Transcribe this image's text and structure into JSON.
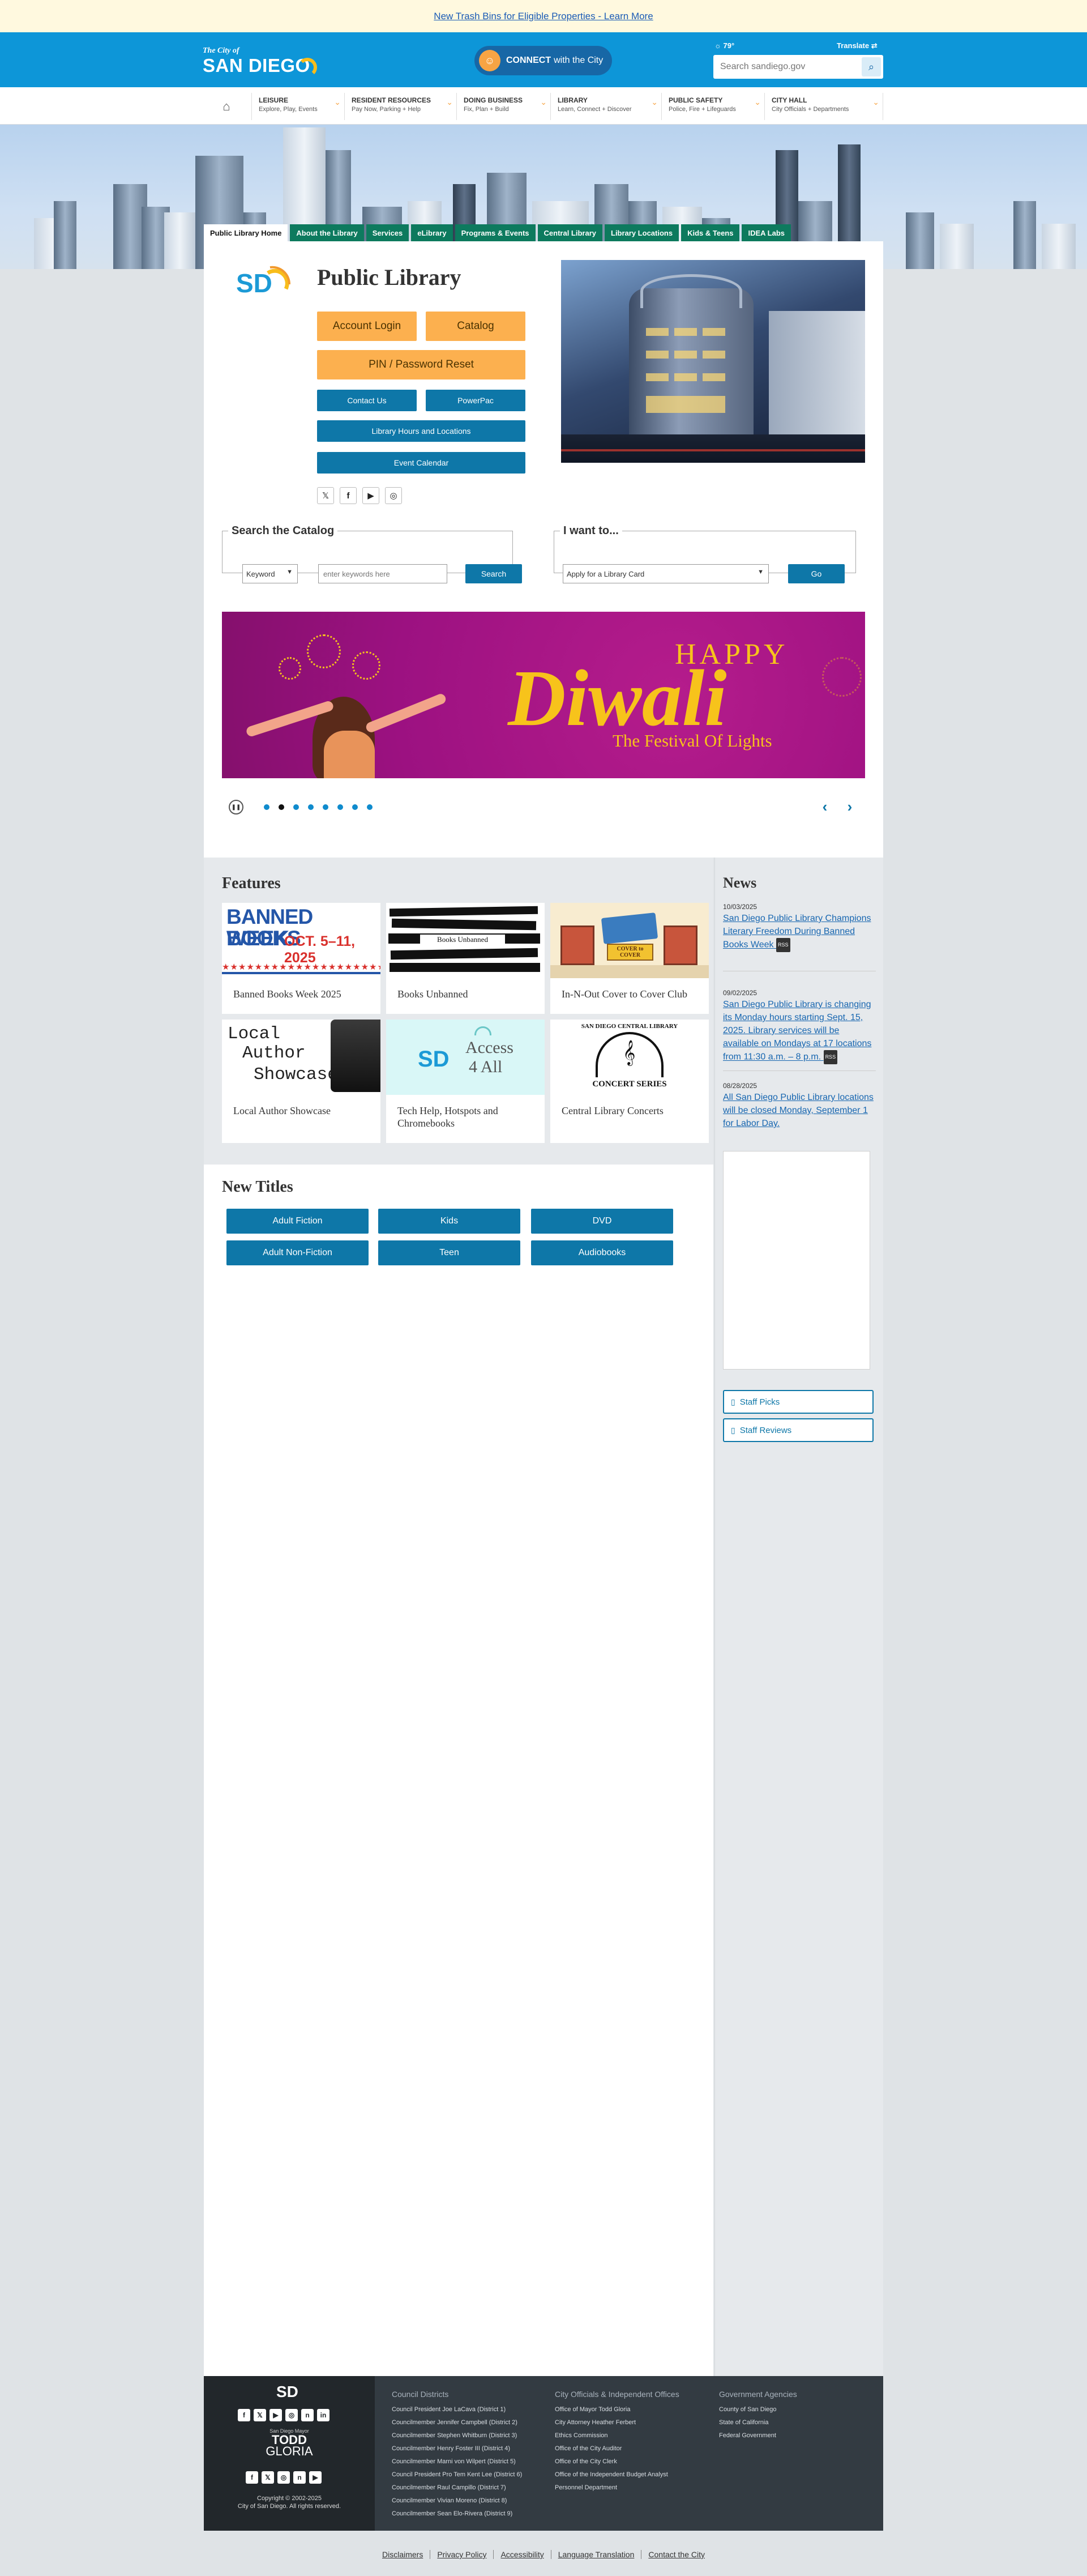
{
  "announcement": "New Trash Bins for Eligible Properties - Learn More",
  "header": {
    "logo_small": "The City of",
    "logo_big": "SAN DIEGO",
    "connect_bold": "CONNECT",
    "connect_rest": "with the City",
    "weather": "79°",
    "translate": "Translate",
    "search_placeholder": "Search sandiego.gov"
  },
  "nav": [
    {
      "title": "LEISURE",
      "sub": "Explore, Play, Events"
    },
    {
      "title": "RESIDENT RESOURCES",
      "sub": "Pay Now, Parking + Help"
    },
    {
      "title": "DOING BUSINESS",
      "sub": "Fix, Plan + Build"
    },
    {
      "title": "LIBRARY",
      "sub": "Learn, Connect + Discover"
    },
    {
      "title": "PUBLIC SAFETY",
      "sub": "Police, Fire + Lifeguards"
    },
    {
      "title": "CITY HALL",
      "sub": "City Officials + Departments"
    }
  ],
  "lib_tabs": [
    "Public Library Home",
    "About the Library",
    "Services",
    "eLibrary",
    "Programs & Events",
    "Central Library",
    "Library Locations",
    "Kids & Teens",
    "IDEA Labs"
  ],
  "library": {
    "logo_text": "SD",
    "title": "Public Library",
    "account_login": "Account Login",
    "catalog": "Catalog",
    "pin_reset": "PIN / Password Reset",
    "contact_us": "Contact Us",
    "powerpac": "PowerPac",
    "hours": "Library Hours and Locations",
    "event_calendar": "Event Calendar"
  },
  "catalog_search": {
    "legend": "Search the Catalog",
    "type_selected": "Keyword",
    "placeholder": "enter keywords here",
    "button": "Search"
  },
  "i_want": {
    "legend": "I want to...",
    "selected": "Apply for a Library Card",
    "button": "Go"
  },
  "banner": {
    "happy": "HAPPY",
    "diwali": "Diwali",
    "subtitle": "The Festival Of Lights"
  },
  "carousel": {
    "slides": 8,
    "active": 1
  },
  "features": {
    "title": "Features",
    "cards": [
      {
        "caption": "Banned Books Week 2025",
        "img_line1": "BANNED BOOKS",
        "img_line2": "WEEK",
        "img_line3": "OCT. 5–11, 2025"
      },
      {
        "caption": "Books Unbanned",
        "img_line1": "Books Unbanned"
      },
      {
        "caption": "In-N-Out Cover to Cover Club",
        "img_line1": "COVER to COVER"
      },
      {
        "caption": "Local Author Showcase",
        "img_line1": "Local",
        "img_line2": "Author",
        "img_line3": "Showcase"
      },
      {
        "caption": "Tech Help, Hotspots and Chromebooks",
        "img_line1": "Access",
        "img_line2": "4 All",
        "img_logo": "SD"
      },
      {
        "caption": "Central Library Concerts",
        "img_line1": "SAN DIEGO CENTRAL LIBRARY",
        "img_line2": "CONCERT SERIES"
      }
    ]
  },
  "news": {
    "title": "News",
    "rss": "RSS",
    "items": [
      {
        "date": "10/03/2025",
        "text": "San Diego Public Library Champions Literary Freedom During Banned Books Week"
      },
      {
        "date": "09/02/2025",
        "text": "San Diego Public Library is changing its Monday hours starting Sept. 15, 2025. Library services will be available on Mondays at 17 locations from 11:30 a.m. – 8 p.m."
      },
      {
        "date": "08/28/2025",
        "text": "All San Diego Public Library locations will be closed Monday, September 1 for Labor Day."
      }
    ],
    "staff_picks": "Staff Picks",
    "staff_reviews": "Staff Reviews"
  },
  "new_titles": {
    "title": "New Titles",
    "buttons": [
      "Adult Fiction",
      "Kids",
      "DVD",
      "Adult Non-Fiction",
      "Teen",
      "Audiobooks"
    ]
  },
  "footer": {
    "logo_text": "SD",
    "mayor_small": "San Diego Mayor",
    "mayor_name1": "TODD",
    "mayor_name2": "GLORIA",
    "copyright1": "Copyright © 2002-2025",
    "copyright2": "City of San Diego. All rights reserved.",
    "council": {
      "heading": "Council Districts",
      "items": [
        "Council President Joe LaCava (District 1)",
        "Councilmember Jennifer Campbell (District 2)",
        "Councilmember Stephen Whitburn (District 3)",
        "Councilmember Henry Foster III (District 4)",
        "Councilmember Marni von Wilpert (District 5)",
        "Council President Pro Tem Kent Lee (District 6)",
        "Councilmember Raul Campillo (District 7)",
        "Councilmember Vivian Moreno (District 8)",
        "Councilmember Sean Elo-Rivera (District 9)"
      ]
    },
    "officials": {
      "heading": "City Officials & Independent Offices",
      "items": [
        "Office of Mayor Todd Gloria",
        "City Attorney Heather Ferbert",
        "Ethics Commission",
        "Office of the City Auditor",
        "Office of the City Clerk",
        "Office of the Independent Budget Analyst",
        "Personnel Department"
      ]
    },
    "agencies": {
      "heading": "Government Agencies",
      "items": [
        "County of San Diego",
        "State of California",
        "Federal Government"
      ]
    }
  },
  "bottom_links": [
    "Disclaimers",
    "Privacy Policy",
    "Accessibility",
    "Language Translation",
    "Contact the City"
  ],
  "colors": {
    "header_blue": "#0d96d8",
    "tab_green": "#0d7a5e",
    "button_blue": "#0e77a8",
    "button_orange": "#fcb04f",
    "banner_magenta": "#9c1181",
    "banner_gold": "#f7c31b"
  }
}
